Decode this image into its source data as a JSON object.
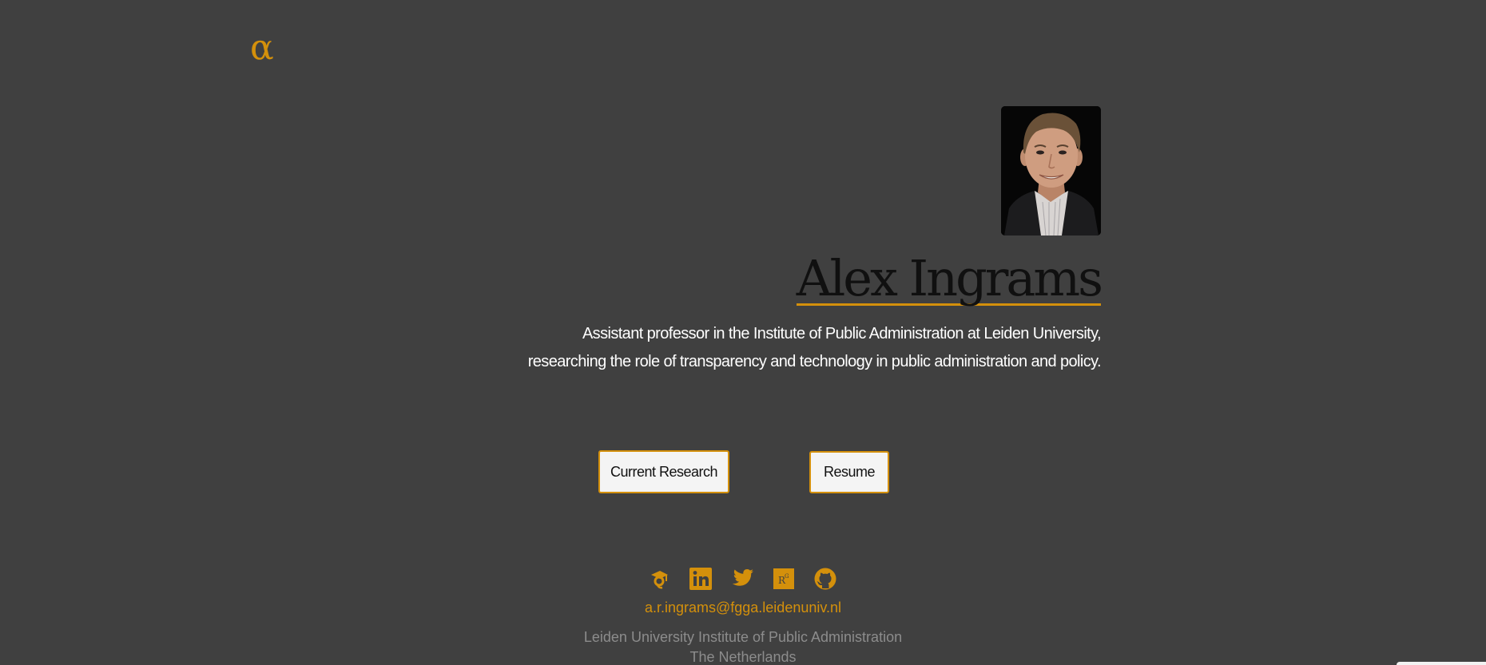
{
  "header": {
    "logo_text": "α"
  },
  "profile": {
    "name": "Alex Ingrams",
    "bio_line1": "Assistant professor in the Institute of Public Administration at Leiden University,",
    "bio_line2": "researching the role of transparency and technology in public administration and policy."
  },
  "buttons": {
    "research_label": "Current Research",
    "resume_label": "Resume"
  },
  "footer": {
    "social_icons": [
      "google-scholar-icon",
      "linkedin-icon",
      "twitter-icon",
      "researchgate-icon",
      "github-icon"
    ],
    "email": "a.r.ingrams@fgga.leidenuniv.nl",
    "affiliation_line1": "Leiden University Institute of Public Administration",
    "affiliation_line2": "The Netherlands"
  },
  "colors": {
    "background": "#404040",
    "accent": "#d4900b",
    "button_bg": "#f4f4f4",
    "muted_text": "#8c8c8c"
  }
}
